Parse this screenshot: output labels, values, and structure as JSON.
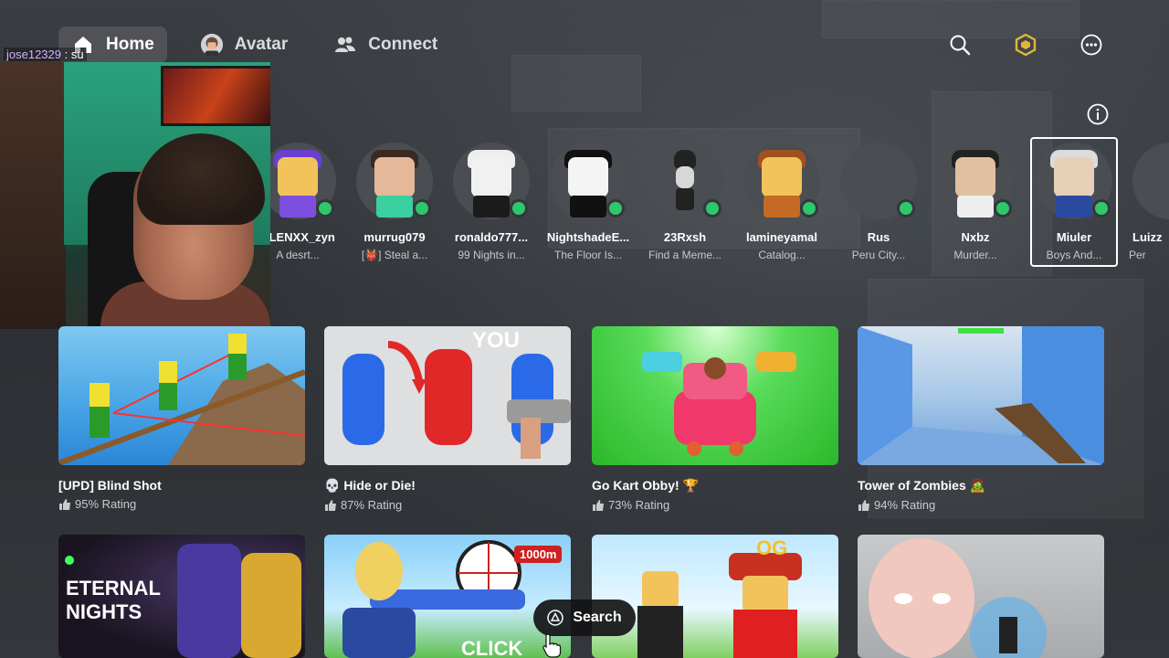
{
  "nav": {
    "home": "Home",
    "avatar": "Avatar",
    "connect": "Connect"
  },
  "top_right_icons": [
    "search-icon",
    "robux-icon",
    "more-icon"
  ],
  "webcam": {
    "username": "jose12329",
    "suffix": ": su"
  },
  "friends": [
    {
      "name": "ALENXX_zyn",
      "status": "A desrt..."
    },
    {
      "name": "murrug079",
      "status": "[👹] Steal a..."
    },
    {
      "name": "ronaldo777...",
      "status": "99 Nights in..."
    },
    {
      "name": "NightshadeE...",
      "status": "The Floor Is..."
    },
    {
      "name": "23Rxsh",
      "status": "Find a Meme..."
    },
    {
      "name": "lamineyamal",
      "status": "Catalog..."
    },
    {
      "name": "Rus",
      "status": "Peru City..."
    },
    {
      "name": "Nxbz",
      "status": "Murder..."
    },
    {
      "name": "Miuler",
      "status": "Boys And..."
    },
    {
      "name": "Luizz",
      "status": "Per"
    }
  ],
  "games_row1": [
    {
      "title": "[UPD] Blind Shot",
      "rating": "95% Rating"
    },
    {
      "title": "💀 Hide or Die!",
      "rating": "87% Rating"
    },
    {
      "title": "Go Kart Obby! 🏆",
      "rating": "73% Rating"
    },
    {
      "title": "Tower of Zombies 🧟",
      "rating": "94% Rating"
    }
  ],
  "thumb_text": {
    "you": "YOU",
    "eternal": "ETERNAL",
    "nights": "NIGHTS",
    "og": "OG",
    "distance": "1000m",
    "click": "CLICK"
  },
  "search_button": "Search",
  "colors": {
    "online_dot": "#2ec76a",
    "robux": "#e0b53a"
  }
}
